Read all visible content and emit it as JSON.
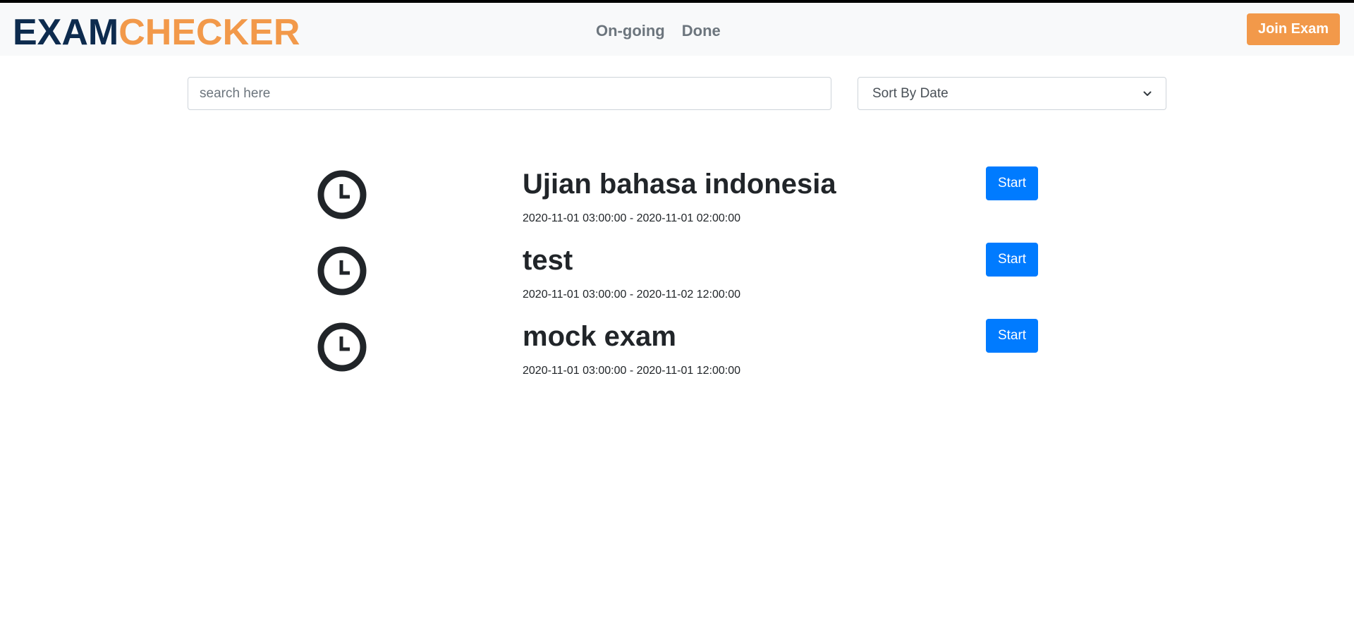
{
  "brand": {
    "part1": "EXAM",
    "part2": "CHECKER",
    "color1": "#0d2b4e",
    "color2": "#f2994a"
  },
  "nav": {
    "links": [
      {
        "label": "On-going"
      },
      {
        "label": "Done"
      }
    ],
    "join_label": "Join Exam"
  },
  "controls": {
    "search_placeholder": "search here",
    "sort_selected": "Sort By Date"
  },
  "exams": [
    {
      "title": "Ujian bahasa indonesia",
      "time": "2020-11-01 03:00:00 - 2020-11-01 02:00:00",
      "action": "Start",
      "icon": "clock-icon"
    },
    {
      "title": "test",
      "time": "2020-11-01 03:00:00 - 2020-11-02 12:00:00",
      "action": "Start",
      "icon": "clock-icon"
    },
    {
      "title": "mock exam",
      "time": "2020-11-01 03:00:00 - 2020-11-01 12:00:00",
      "action": "Start",
      "icon": "clock-icon"
    }
  ],
  "colors": {
    "accent": "#f2994a",
    "primary": "#007bff",
    "navbar_bg": "#f8f9fa"
  }
}
